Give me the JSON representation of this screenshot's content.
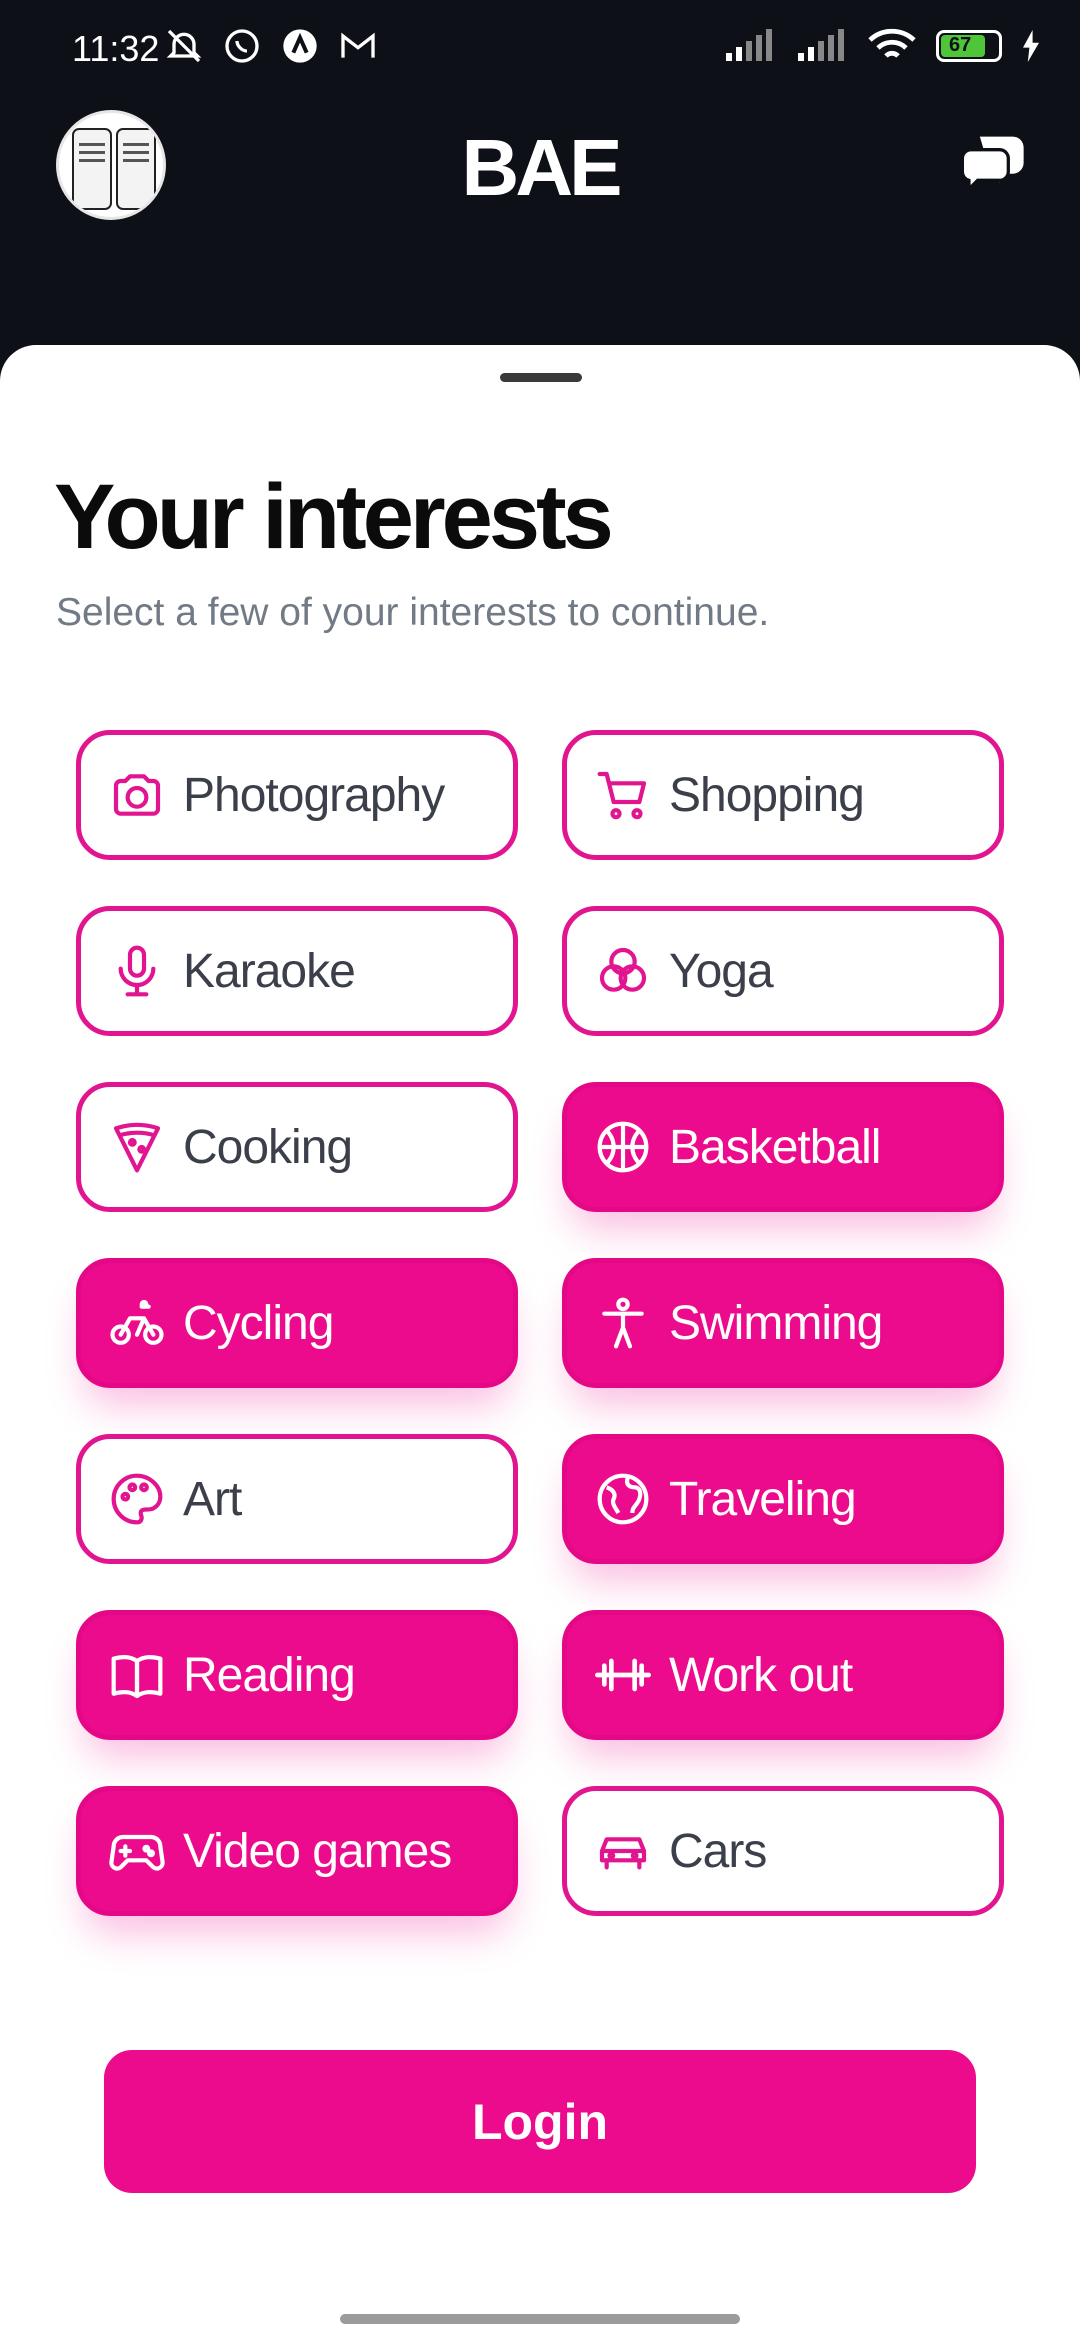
{
  "status_bar": {
    "time": "11:32",
    "battery": "67"
  },
  "header": {
    "brand": "BAE"
  },
  "sheet": {
    "title": "Your interests",
    "subtitle": "Select a few of your interests to continue."
  },
  "interests": [
    {
      "label": "Photography",
      "icon": "camera-icon",
      "selected": false
    },
    {
      "label": "Shopping",
      "icon": "cart-icon",
      "selected": false
    },
    {
      "label": "Karaoke",
      "icon": "microphone-icon",
      "selected": false
    },
    {
      "label": "Yoga",
      "icon": "yoga-icon",
      "selected": false
    },
    {
      "label": "Cooking",
      "icon": "pizza-icon",
      "selected": false
    },
    {
      "label": "Basketball",
      "icon": "basketball-icon",
      "selected": true
    },
    {
      "label": "Cycling",
      "icon": "bicycle-icon",
      "selected": true
    },
    {
      "label": "Swimming",
      "icon": "person-icon",
      "selected": true
    },
    {
      "label": "Art",
      "icon": "palette-icon",
      "selected": false
    },
    {
      "label": "Traveling",
      "icon": "globe-icon",
      "selected": true
    },
    {
      "label": "Reading",
      "icon": "book-icon",
      "selected": true
    },
    {
      "label": "Work out",
      "icon": "dumbbell-icon",
      "selected": true
    },
    {
      "label": "Video games",
      "icon": "gamepad-icon",
      "selected": true
    },
    {
      "label": "Cars",
      "icon": "car-icon",
      "selected": false
    }
  ],
  "actions": {
    "login_label": "Login"
  },
  "colors": {
    "accent": "#ec0b8c",
    "header_bg": "#0d1017"
  }
}
